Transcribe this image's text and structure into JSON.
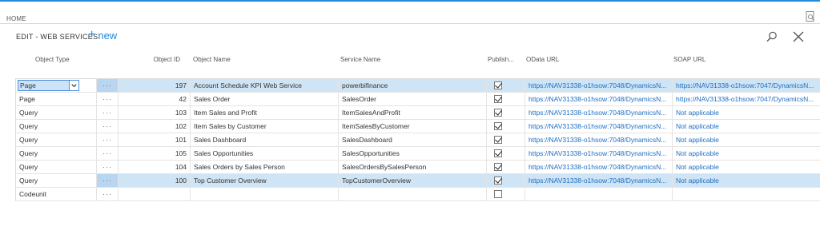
{
  "topbar": {
    "home_label": "HOME"
  },
  "header": {
    "title": "EDIT - WEB SERVICES",
    "new_label": "new"
  },
  "columns": {
    "object_type": "Object Type",
    "object_id": "Object ID",
    "object_name": "Object Name",
    "service_name": "Service Name",
    "published": "Publish...",
    "odata_url": "OData URL",
    "soap_url": "SOAP URL"
  },
  "rows": [
    {
      "object_type": "Page",
      "dots": "···",
      "object_id": "197",
      "object_name": "Account Schedule KPI Web Service",
      "service_name": "powerbifinance",
      "published": true,
      "odata_url": "https://NAV31338-o1hsow:7048/DynamicsN...",
      "soap_url": "https://NAV31338-o1hsow:7047/DynamicsN..."
    },
    {
      "object_type": "Page",
      "dots": "···",
      "object_id": "42",
      "object_name": "Sales Order",
      "service_name": "SalesOrder",
      "published": true,
      "odata_url": "https://NAV31338-o1hsow:7048/DynamicsN...",
      "soap_url": "https://NAV31338-o1hsow:7047/DynamicsN..."
    },
    {
      "object_type": "Query",
      "dots": "···",
      "object_id": "103",
      "object_name": "Item Sales and Profit",
      "service_name": "ItemSalesAndProfit",
      "published": true,
      "odata_url": "https://NAV31338-o1hsow:7048/DynamicsN...",
      "soap_url": "Not applicable"
    },
    {
      "object_type": "Query",
      "dots": "···",
      "object_id": "102",
      "object_name": "Item Sales by Customer",
      "service_name": "ItemSalesByCustomer",
      "published": true,
      "odata_url": "https://NAV31338-o1hsow:7048/DynamicsN...",
      "soap_url": "Not applicable"
    },
    {
      "object_type": "Query",
      "dots": "···",
      "object_id": "101",
      "object_name": "Sales Dashboard",
      "service_name": "SalesDashboard",
      "published": true,
      "odata_url": "https://NAV31338-o1hsow:7048/DynamicsN...",
      "soap_url": "Not applicable"
    },
    {
      "object_type": "Query",
      "dots": "···",
      "object_id": "105",
      "object_name": "Sales Opportunities",
      "service_name": "SalesOpportunities",
      "published": true,
      "odata_url": "https://NAV31338-o1hsow:7048/DynamicsN...",
      "soap_url": "Not applicable"
    },
    {
      "object_type": "Query",
      "dots": "···",
      "object_id": "104",
      "object_name": "Sales Orders by Sales Person",
      "service_name": "SalesOrdersBySalesPerson",
      "published": true,
      "odata_url": "https://NAV31338-o1hsow:7048/DynamicsN...",
      "soap_url": "Not applicable"
    },
    {
      "object_type": "Query",
      "dots": "···",
      "object_id": "100",
      "object_name": "Top Customer Overview",
      "service_name": "TopCustomerOverview",
      "published": true,
      "odata_url": "https://NAV31338-o1hsow:7048/DynamicsN...",
      "soap_url": "Not applicable"
    },
    {
      "object_type": "Codeunit",
      "dots": "···",
      "object_id": "",
      "object_name": "",
      "service_name": "",
      "published": false,
      "odata_url": "",
      "soap_url": ""
    }
  ],
  "icons": {
    "search": "search-icon",
    "close": "close-icon",
    "new": "plus-icon",
    "search_document": "search-document-icon",
    "dropdown": "chevron-down-icon"
  },
  "colors": {
    "accent": "#1f8ad8",
    "link": "#1f6fc1",
    "selected_row": "#cfe4f5"
  }
}
